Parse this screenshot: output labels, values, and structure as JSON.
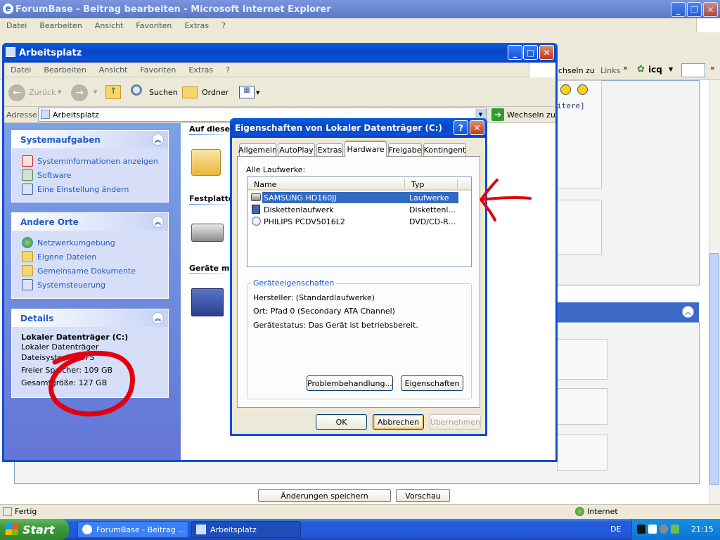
{
  "ie": {
    "title": "ForumBase - Beitrag bearbeiten - Microsoft Internet Explorer",
    "menu": [
      "Datei",
      "Bearbeiten",
      "Ansicht",
      "Favoriten",
      "Extras",
      "?"
    ],
    "wechseln": "chseln zu",
    "links": "Links",
    "icq": "icq",
    "buttons": {
      "save": "Änderungen speichern",
      "preview": "Vorschau"
    },
    "status": "Fertig",
    "zone": "Internet",
    "side_text": "itere]"
  },
  "explorer": {
    "title": "Arbeitsplatz",
    "menu": [
      "Datei",
      "Bearbeiten",
      "Ansicht",
      "Favoriten",
      "Extras",
      "?"
    ],
    "toolbar": {
      "back": "Zurück",
      "search": "Suchen",
      "folders": "Ordner"
    },
    "address_label": "Adresse",
    "address_value": "Arbeitsplatz",
    "go": "Wechseln zu",
    "groups": {
      "files": "Auf diesem",
      "drives": "Festplatte",
      "removable": "Geräte mi"
    },
    "tasks": {
      "system": {
        "title": "Systemaufgaben",
        "items": [
          "Systeminformationen anzeigen",
          "Software",
          "Eine Einstellung ändern"
        ]
      },
      "places": {
        "title": "Andere Orte",
        "items": [
          "Netzwerkumgebung",
          "Eigene Dateien",
          "Gemeinsame Dokumente",
          "Systemsteuerung"
        ]
      },
      "details": {
        "title": "Details",
        "name": "Lokaler Datenträger (C:)",
        "type": "Lokaler Datenträger",
        "fs": "Dateisystem: NTFS",
        "free": "Freier Speicher: 109 GB",
        "total": "Gesamtgröße: 127 GB"
      }
    }
  },
  "dialog": {
    "title": "Eigenschaften von Lokaler Datenträger (C:)",
    "tabs": [
      "Allgemein",
      "AutoPlay",
      "Extras",
      "Hardware",
      "Freigabe",
      "Kontingent"
    ],
    "active_tab": "Hardware",
    "all_drives_label": "Alle Laufwerke:",
    "columns": [
      "Name",
      "Typ"
    ],
    "rows": [
      {
        "name": "SAMSUNG HD160JJ",
        "type": "Laufwerke"
      },
      {
        "name": "Diskettenlaufwerk",
        "type": "Diskettenl..."
      },
      {
        "name": "PHILIPS PCDV5016L2",
        "type": "DVD/CD-R..."
      }
    ],
    "props_title": "Geräteeigenschaften",
    "manufacturer": "Hersteller: (Standardlaufwerke)",
    "location": "Ort: Pfad 0 (Secondary ATA Channel)",
    "status": "Gerätestatus: Das Gerät ist betriebsbereit.",
    "troubleshoot": "Problembehandlung...",
    "properties": "Eigenschaften",
    "ok": "OK",
    "cancel": "Abbrechen",
    "apply": "Übernehmen"
  },
  "taskbar": {
    "start": "Start",
    "items": [
      "ForumBase - Beitrag ...",
      "Arbeitsplatz"
    ],
    "lang": "DE",
    "clock": "21:15"
  },
  "colors": {
    "accent": "#0a4fd6",
    "annotation": "#e3000f",
    "selection": "#316ac5"
  }
}
